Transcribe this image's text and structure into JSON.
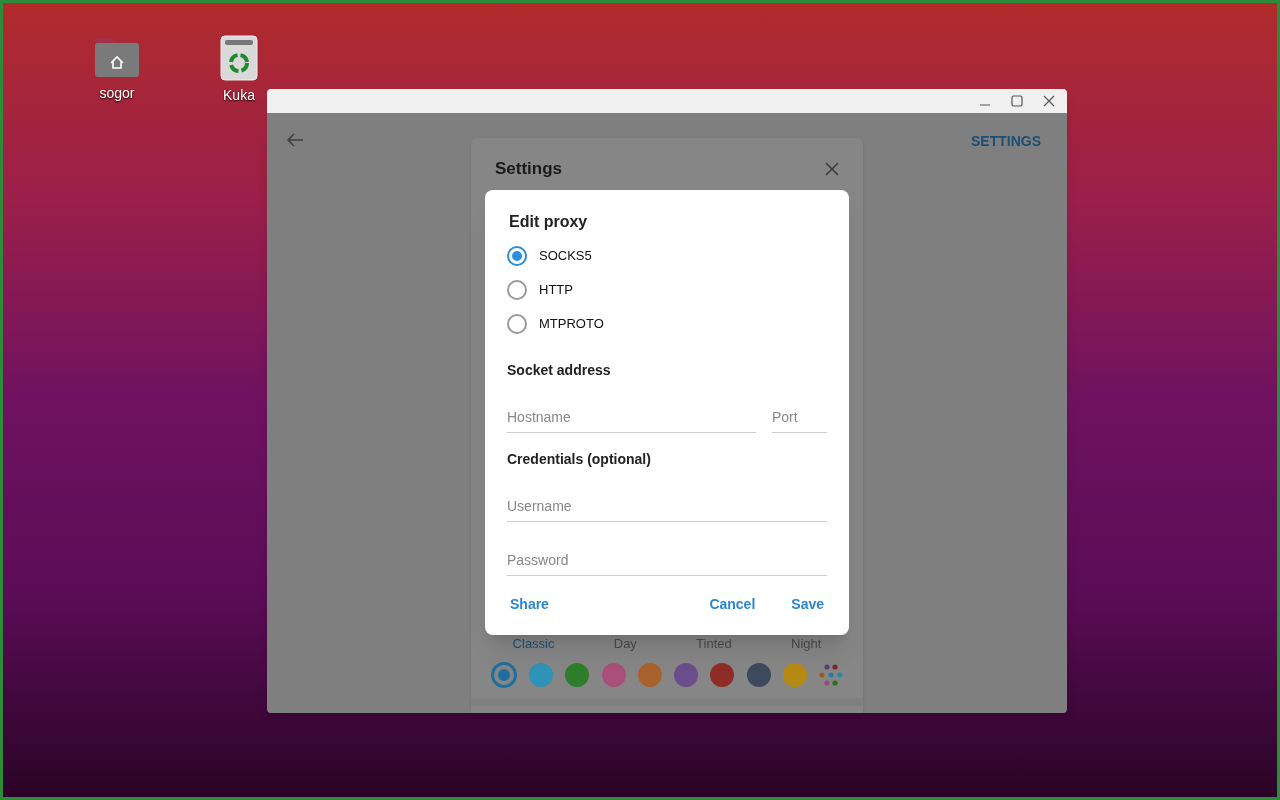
{
  "desktop_icons": [
    {
      "label": "sogor",
      "kind": "home"
    },
    {
      "label": "Kuka",
      "kind": "trash"
    }
  ],
  "app": {
    "header_action": "SETTINGS"
  },
  "settings": {
    "title": "Settings",
    "themes": [
      {
        "label": "Classic",
        "selected": true
      },
      {
        "label": "Day",
        "selected": false
      },
      {
        "label": "Tinted",
        "selected": false
      },
      {
        "label": "Night",
        "selected": false
      }
    ],
    "accent_colors": [
      {
        "color": "#1f6fa0",
        "selected": true
      },
      {
        "color": "#2e93b6",
        "selected": false
      },
      {
        "color": "#2e7d2a",
        "selected": false
      },
      {
        "color": "#a84f7a",
        "selected": false
      },
      {
        "color": "#a8622e",
        "selected": false
      },
      {
        "color": "#6b4d8c",
        "selected": false
      },
      {
        "color": "#8e2d26",
        "selected": false
      },
      {
        "color": "#3d4a5e",
        "selected": false
      },
      {
        "color": "#b58a14",
        "selected": false
      }
    ]
  },
  "dialog": {
    "title": "Edit proxy",
    "types": [
      {
        "label": "SOCKS5",
        "selected": true
      },
      {
        "label": "HTTP",
        "selected": false
      },
      {
        "label": "MTPROTO",
        "selected": false
      }
    ],
    "socket_heading": "Socket address",
    "hostname": {
      "placeholder": "Hostname"
    },
    "port": {
      "placeholder": "Port"
    },
    "credentials_heading": "Credentials (optional)",
    "username": {
      "placeholder": "Username"
    },
    "password": {
      "placeholder": "Password"
    },
    "buttons": {
      "share": "Share",
      "cancel": "Cancel",
      "save": "Save"
    }
  }
}
